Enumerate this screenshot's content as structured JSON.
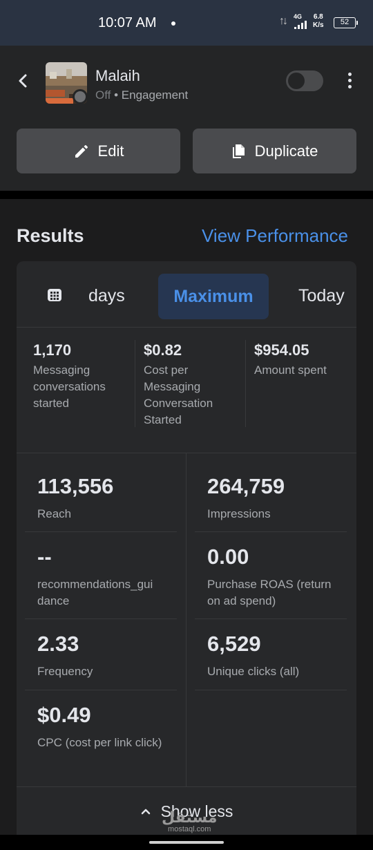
{
  "status_bar": {
    "time": "10:07 AM",
    "network": "4G",
    "speed_value": "6.8",
    "speed_unit": "K/s",
    "battery": "52"
  },
  "header": {
    "ad_name": "Malaih",
    "status": "Off",
    "separator": "•",
    "objective": "Engagement",
    "toggle_on": false,
    "edit_label": "Edit",
    "duplicate_label": "Duplicate"
  },
  "results": {
    "title": "Results",
    "view_performance": "View Performance",
    "tabs": {
      "days": "days",
      "maximum": "Maximum",
      "today": "Today",
      "selected": "Maximum"
    },
    "kpis": [
      {
        "value": "1,170",
        "label": "Messaging conversations started"
      },
      {
        "value": "$0.82",
        "label": "Cost per Messaging Conversation Started"
      },
      {
        "value": "$954.05",
        "label": "Amount spent"
      }
    ],
    "metrics": {
      "reach": {
        "value": "113,556",
        "label": "Reach"
      },
      "impressions": {
        "value": "264,759",
        "label": "Impressions"
      },
      "recommendations": {
        "value": "--",
        "label": "recommendations_gui dance"
      },
      "roas": {
        "value": "0.00",
        "label": "Purchase ROAS (return on ad spend)"
      },
      "frequency": {
        "value": "2.33",
        "label": "Frequency"
      },
      "unique_clicks": {
        "value": "6,529",
        "label": "Unique clicks (all)"
      },
      "cpc": {
        "value": "$0.49",
        "label": "CPC (cost per link click)"
      }
    },
    "show_less": "Show less"
  },
  "watermark": {
    "arabic": "مستقل",
    "latin": "mostaql.com"
  },
  "colors": {
    "accent": "#4a90e8",
    "header_bg": "#242526",
    "card_bg": "#27282a",
    "status_bar_bg": "#2a3342"
  }
}
